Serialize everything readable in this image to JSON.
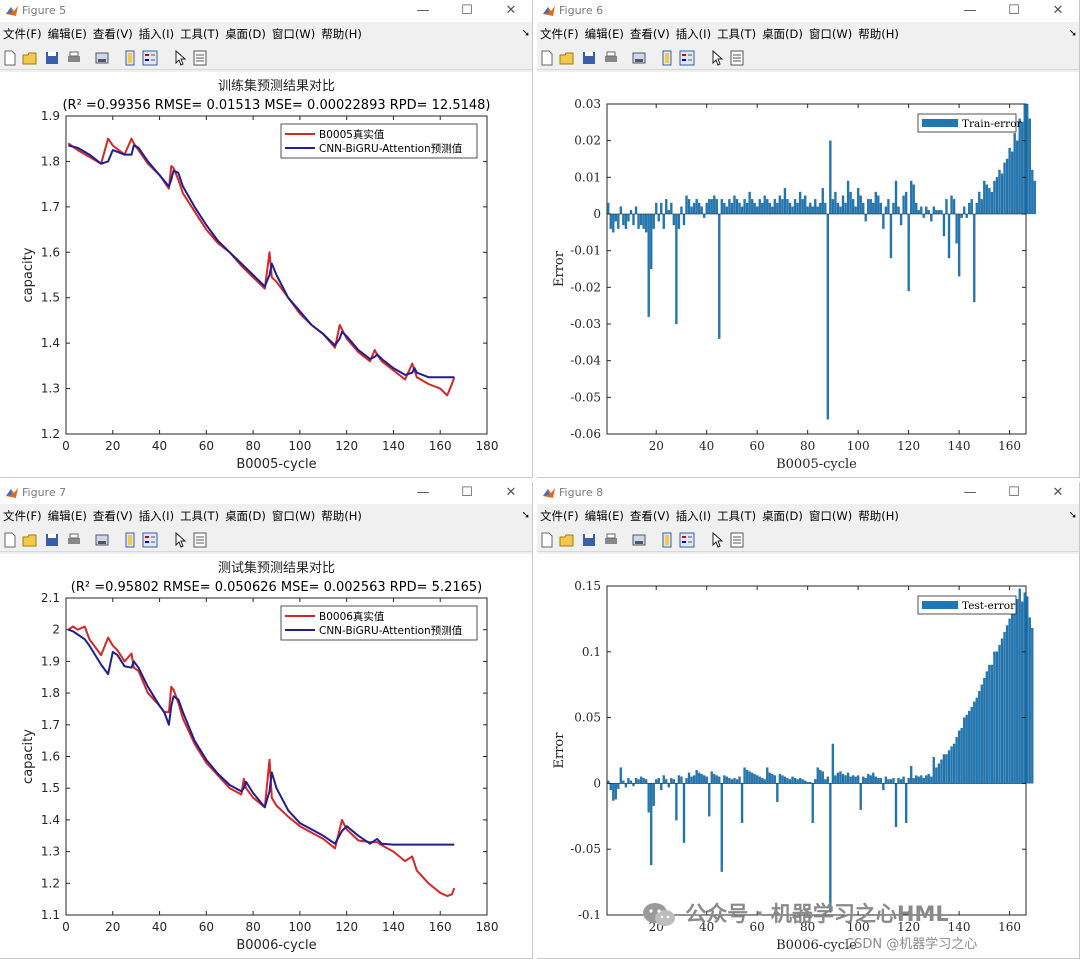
{
  "windows": [
    {
      "id": "w5",
      "title": "Figure 5",
      "x": 0,
      "y": 0,
      "w": 533,
      "h": 478
    },
    {
      "id": "w6",
      "title": "Figure 6",
      "x": 537,
      "y": 0,
      "w": 543,
      "h": 478
    },
    {
      "id": "w7",
      "title": "Figure 7",
      "x": 0,
      "y": 482,
      "w": 533,
      "h": 477
    },
    {
      "id": "w8",
      "title": "Figure 8",
      "x": 537,
      "y": 482,
      "w": 543,
      "h": 477
    }
  ],
  "menu": [
    "文件(F)",
    "编辑(E)",
    "查看(V)",
    "插入(I)",
    "工具(T)",
    "桌面(D)",
    "窗口(W)",
    "帮助(H)"
  ],
  "window_controls": {
    "minimize": "—",
    "maximize": "☐",
    "close": "✕"
  },
  "toolbar_icons": [
    "new-file-icon",
    "open-folder-icon",
    "save-icon",
    "print-icon",
    "print-preview-icon",
    "colorbar-icon",
    "legend-icon",
    "pointer-icon",
    "property-editor-icon"
  ],
  "colors": {
    "true_series": "#d62728",
    "pred_series": "#1f1f8f",
    "bar_fill": "#1f77b4",
    "bar_edge": "#1a5f8f"
  },
  "chart_data": [
    {
      "type": "line",
      "title": "训练集预测结果对比",
      "subtitle": "(R² =0.99356 RMSE= 0.01513 MSE= 0.00022893 RPD= 12.5148)",
      "xlabel": "B0005-cycle",
      "ylabel": "capacity",
      "xlim": [
        0,
        180
      ],
      "ylim": [
        1.2,
        1.9
      ],
      "xticks": [
        0,
        20,
        40,
        60,
        80,
        100,
        120,
        140,
        160,
        180
      ],
      "yticks": [
        1.2,
        1.3,
        1.4,
        1.5,
        1.6,
        1.7,
        1.8,
        1.9
      ],
      "legend_position": "top-right",
      "series": [
        {
          "name": "B0005真实值",
          "role": "true",
          "x": [
            1,
            5,
            10,
            15,
            18,
            20,
            25,
            28,
            29,
            31,
            35,
            40,
            44,
            45,
            46,
            48,
            50,
            55,
            60,
            65,
            70,
            75,
            80,
            85,
            87,
            88,
            90,
            95,
            100,
            105,
            110,
            115,
            117,
            118,
            120,
            125,
            130,
            132,
            133,
            135,
            140,
            145,
            148,
            149,
            150,
            155,
            160,
            162,
            163,
            165,
            166
          ],
          "y": [
            1.84,
            1.825,
            1.81,
            1.795,
            1.85,
            1.835,
            1.815,
            1.85,
            1.84,
            1.825,
            1.795,
            1.77,
            1.74,
            1.79,
            1.785,
            1.76,
            1.73,
            1.69,
            1.65,
            1.62,
            1.6,
            1.57,
            1.545,
            1.52,
            1.6,
            1.545,
            1.535,
            1.5,
            1.465,
            1.44,
            1.42,
            1.39,
            1.44,
            1.43,
            1.41,
            1.38,
            1.36,
            1.385,
            1.375,
            1.36,
            1.34,
            1.32,
            1.355,
            1.34,
            1.325,
            1.31,
            1.3,
            1.29,
            1.285,
            1.31,
            1.325
          ]
        },
        {
          "name": "CNN-BiGRU-Attention预测值",
          "role": "pred",
          "x": [
            1,
            5,
            10,
            15,
            18,
            20,
            25,
            28,
            29,
            31,
            35,
            40,
            44,
            45,
            46,
            48,
            50,
            55,
            60,
            65,
            70,
            75,
            80,
            85,
            87,
            88,
            90,
            95,
            100,
            105,
            110,
            115,
            117,
            118,
            120,
            125,
            130,
            132,
            133,
            135,
            140,
            145,
            148,
            149,
            150,
            155,
            160,
            162,
            163,
            165,
            166
          ],
          "y": [
            1.835,
            1.83,
            1.815,
            1.795,
            1.8,
            1.825,
            1.815,
            1.815,
            1.835,
            1.83,
            1.8,
            1.77,
            1.745,
            1.76,
            1.78,
            1.775,
            1.745,
            1.7,
            1.66,
            1.625,
            1.6,
            1.575,
            1.55,
            1.525,
            1.55,
            1.575,
            1.55,
            1.5,
            1.47,
            1.44,
            1.42,
            1.395,
            1.41,
            1.425,
            1.415,
            1.385,
            1.365,
            1.37,
            1.375,
            1.365,
            1.345,
            1.33,
            1.335,
            1.345,
            1.335,
            1.325,
            1.325,
            1.325,
            1.325,
            1.325,
            1.325
          ]
        }
      ]
    },
    {
      "type": "bar",
      "title": "",
      "xlabel": "B0005-cycle",
      "ylabel": "Error",
      "xlim": [
        0.5,
        166.5
      ],
      "ylim": [
        -0.06,
        0.03
      ],
      "xticks": [
        20,
        40,
        60,
        80,
        100,
        120,
        140,
        160
      ],
      "yticks": [
        -0.06,
        -0.05,
        -0.04,
        -0.03,
        -0.02,
        -0.01,
        0,
        0.01,
        0.02,
        0.03
      ],
      "ytick_labels": [
        "-0.06",
        "-0.05",
        "-0.04",
        "-0.03",
        "-0.02",
        "-0.01",
        "0",
        "0.01",
        "0.02",
        "0.03"
      ],
      "legend_position": "top-right",
      "series": [
        {
          "name": "Train-error",
          "values": [
            0.003,
            -0.004,
            -0.005,
            -0.002,
            -0.004,
            0.002,
            -0.003,
            -0.004,
            -0.002,
            0.001,
            -0.003,
            0.002,
            -0.004,
            -0.003,
            -0.004,
            -0.005,
            -0.028,
            -0.015,
            -0.004,
            0.003,
            -0.002,
            0.003,
            -0.004,
            0.004,
            0.001,
            0.003,
            -0.003,
            -0.03,
            -0.004,
            0.002,
            -0.003,
            0.005,
            0.004,
            0.002,
            0.003,
            0.004,
            0.003,
            0.002,
            -0.001,
            0.003,
            0.004,
            0.004,
            0.005,
            0.004,
            -0.034,
            0.004,
            0.003,
            0.002,
            0.004,
            0.003,
            0.005,
            0.004,
            0.003,
            0.002,
            0.004,
            0.003,
            0.006,
            0.004,
            0.003,
            0.002,
            0.004,
            0.003,
            0.005,
            0.004,
            0.003,
            0.002,
            0.004,
            0.003,
            0.005,
            0.004,
            0.007,
            0.004,
            0.003,
            0.002,
            0.004,
            0.003,
            0.006,
            0.004,
            0.005,
            0.002,
            0.003,
            0.002,
            0.004,
            0.002,
            0.003,
            0.007,
            0.003,
            -0.056,
            0.02,
            0.004,
            0.006,
            0.003,
            0.002,
            0.005,
            0.003,
            0.009,
            0.006,
            0.004,
            0.002,
            0.007,
            0.005,
            0.003,
            -0.002,
            0.004,
            0.004,
            0.003,
            0.006,
            0.005,
            0.003,
            -0.004,
            0.002,
            0.004,
            -0.012,
            0.003,
            0.009,
            0.002,
            -0.003,
            0.005,
            0.006,
            -0.021,
            0.009,
            0.008,
            0.003,
            0.001,
            0.002,
            -0.001,
            0.002,
            0.001,
            -0.002,
            0.002,
            0.001,
            0.001,
            0.001,
            -0.006,
            0.004,
            -0.012,
            0.005,
            0.004,
            -0.008,
            -0.017,
            -0.001,
            0.002,
            -0.001,
            0.003,
            0.004,
            -0.024,
            0.003,
            0.006,
            0.004,
            0.009,
            0.008,
            0.007,
            0.006,
            0.009,
            0.01,
            0.012,
            0.011,
            0.014,
            0.015,
            0.018,
            0.017,
            0.022,
            0.02,
            0.026,
            0.025,
            0.03,
            0.03,
            0.026,
            0.012,
            0.009
          ]
        }
      ]
    },
    {
      "type": "line",
      "title": "测试集预测结果对比",
      "subtitle": "(R² =0.95802 RMSE= 0.050626 MSE= 0.002563 RPD= 5.2165)",
      "xlabel": "B0006-cycle",
      "ylabel": "capacity",
      "xlim": [
        0,
        180
      ],
      "ylim": [
        1.1,
        2.1
      ],
      "xticks": [
        0,
        20,
        40,
        60,
        80,
        100,
        120,
        140,
        160,
        180
      ],
      "yticks": [
        1.1,
        1.2,
        1.3,
        1.4,
        1.5,
        1.6,
        1.7,
        1.8,
        1.9,
        2.0,
        2.1
      ],
      "ytick_labels": [
        "1.1",
        "1.2",
        "1.3",
        "1.4",
        "1.5",
        "1.6",
        "1.7",
        "1.8",
        "1.9",
        "2",
        "2.1"
      ],
      "legend_position": "top-right",
      "series": [
        {
          "name": "B0006真实值",
          "role": "true",
          "x": [
            1,
            3,
            5,
            8,
            10,
            15,
            18,
            20,
            22,
            25,
            28,
            29,
            31,
            35,
            40,
            42,
            44,
            45,
            46,
            48,
            50,
            55,
            60,
            65,
            70,
            75,
            76,
            77,
            80,
            85,
            87,
            88,
            90,
            95,
            100,
            105,
            110,
            115,
            118,
            120,
            125,
            130,
            133,
            135,
            140,
            145,
            148,
            150,
            155,
            160,
            163,
            165,
            166
          ],
          "y": [
            2.0,
            2.01,
            2.0,
            2.01,
            1.97,
            1.92,
            1.975,
            1.95,
            1.935,
            1.9,
            1.925,
            1.88,
            1.87,
            1.8,
            1.76,
            1.74,
            1.74,
            1.82,
            1.81,
            1.77,
            1.72,
            1.64,
            1.58,
            1.54,
            1.5,
            1.48,
            1.53,
            1.5,
            1.47,
            1.44,
            1.59,
            1.47,
            1.445,
            1.41,
            1.38,
            1.36,
            1.34,
            1.31,
            1.4,
            1.37,
            1.335,
            1.33,
            1.33,
            1.32,
            1.3,
            1.27,
            1.285,
            1.24,
            1.2,
            1.17,
            1.16,
            1.165,
            1.185
          ]
        },
        {
          "name": "CNN-BiGRU-Attention预测值",
          "role": "pred",
          "x": [
            1,
            3,
            5,
            8,
            10,
            15,
            18,
            20,
            22,
            25,
            28,
            29,
            31,
            35,
            40,
            42,
            44,
            45,
            46,
            48,
            50,
            55,
            60,
            65,
            70,
            75,
            76,
            77,
            80,
            85,
            87,
            88,
            90,
            95,
            100,
            105,
            110,
            115,
            118,
            120,
            125,
            130,
            133,
            135,
            140,
            145,
            148,
            150,
            155,
            160,
            163,
            165,
            166
          ],
          "y": [
            2.0,
            1.995,
            1.985,
            1.97,
            1.95,
            1.89,
            1.86,
            1.93,
            1.92,
            1.885,
            1.88,
            1.9,
            1.88,
            1.82,
            1.76,
            1.74,
            1.7,
            1.76,
            1.79,
            1.78,
            1.74,
            1.65,
            1.59,
            1.545,
            1.51,
            1.49,
            1.5,
            1.52,
            1.485,
            1.44,
            1.49,
            1.55,
            1.5,
            1.43,
            1.39,
            1.37,
            1.35,
            1.325,
            1.365,
            1.38,
            1.35,
            1.325,
            1.34,
            1.325,
            1.322,
            1.322,
            1.322,
            1.322,
            1.322,
            1.322,
            1.322,
            1.322,
            1.322
          ]
        }
      ]
    },
    {
      "type": "bar",
      "title": "",
      "xlabel": "B0006-cycle",
      "ylabel": "Error",
      "xlim": [
        0.5,
        166.5
      ],
      "ylim": [
        -0.1,
        0.15
      ],
      "xticks": [
        20,
        40,
        60,
        80,
        100,
        120,
        140,
        160
      ],
      "yticks": [
        -0.1,
        -0.05,
        0,
        0.05,
        0.1,
        0.15
      ],
      "ytick_labels": [
        "-0.1",
        "-0.05",
        "0",
        "0.05",
        "0.1",
        "0.15"
      ],
      "legend_position": "top-right",
      "series": [
        {
          "name": "Test-error",
          "values": [
            0.002,
            -0.005,
            -0.013,
            -0.012,
            -0.004,
            0.012,
            0.002,
            -0.003,
            0.004,
            0.002,
            -0.002,
            0.004,
            0.003,
            0.005,
            0.004,
            0.003,
            -0.022,
            -0.062,
            -0.017,
            0.003,
            0.004,
            -0.005,
            0.006,
            0.003,
            -0.003,
            0.004,
            0.003,
            -0.028,
            0.006,
            0.005,
            -0.045,
            0.004,
            0.008,
            0.005,
            0.006,
            0.01,
            0.008,
            0.007,
            0.006,
            0.005,
            -0.025,
            0.009,
            0.007,
            0.006,
            0.005,
            -0.067,
            0.006,
            0.005,
            0.004,
            0.003,
            0.004,
            0.003,
            0.005,
            -0.03,
            0.012,
            0.01,
            0.009,
            0.008,
            0.007,
            0.006,
            0.005,
            0.004,
            0.003,
            0.012,
            0.008,
            0.007,
            0.006,
            -0.014,
            0.007,
            0.006,
            0.005,
            0.004,
            0.003,
            0.005,
            0.004,
            0.003,
            0.004,
            0.003,
            0.002,
            0.001,
            0.001,
            -0.03,
            0.003,
            0.012,
            0.01,
            0.009,
            0.003,
            0.005,
            -0.098,
            0.03,
            0.006,
            0.008,
            0.009,
            0.007,
            0.006,
            0.008,
            0.005,
            0.006,
            0.005,
            0.006,
            -0.02,
            0.005,
            0.004,
            0.007,
            0.006,
            0.008,
            0.005,
            0.004,
            0.004,
            -0.005,
            0.005,
            0.003,
            0.003,
            0.004,
            -0.033,
            0.004,
            0.003,
            0.005,
            -0.03,
            0.004,
            0.013,
            0.004,
            0.006,
            0.005,
            0.006,
            0.004,
            0.006,
            0.007,
            0.005,
            0.02,
            0.012,
            0.015,
            0.018,
            0.022,
            0.022,
            0.025,
            0.028,
            0.03,
            0.035,
            0.04,
            0.042,
            0.05,
            0.052,
            0.055,
            0.058,
            0.062,
            0.065,
            0.07,
            0.075,
            0.08,
            0.085,
            0.09,
            0.09,
            0.1,
            0.1,
            0.105,
            0.11,
            0.115,
            0.12,
            0.125,
            0.13,
            0.135,
            0.14,
            0.148,
            0.138,
            0.145,
            0.142,
            0.126,
            0.118
          ]
        }
      ]
    }
  ],
  "watermark": {
    "text": "公众号 · 机器学习之心HML",
    "csdn": "CSDN @机器学习之心"
  }
}
